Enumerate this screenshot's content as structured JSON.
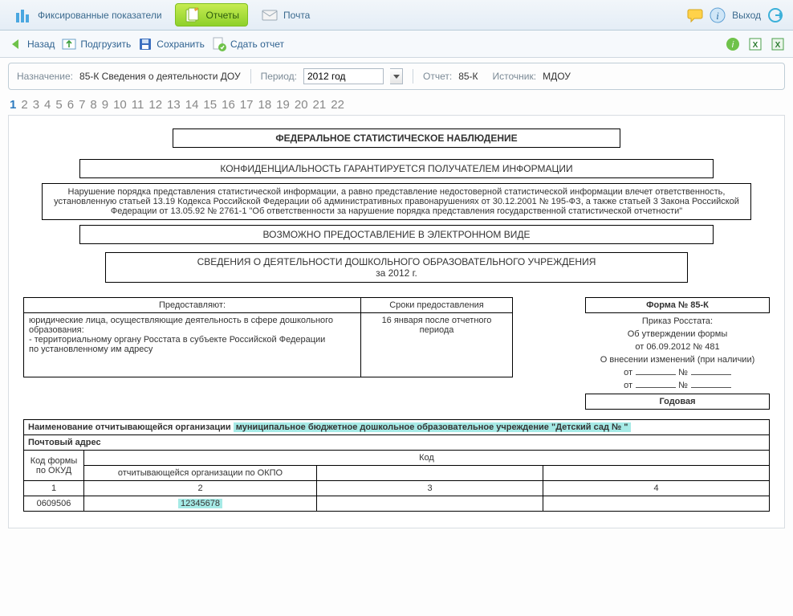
{
  "toolbar1": {
    "fixed": "Фиксированные показатели",
    "reports": "Отчеты",
    "mail": "Почта",
    "exit": "Выход"
  },
  "toolbar2": {
    "back": "Назад",
    "upload": "Подгрузить",
    "save": "Сохранить",
    "submit": "Сдать отчет"
  },
  "meta": {
    "purpose_label": "Назначение:",
    "purpose_value": "85-К Сведения о деятельности ДОУ",
    "period_label": "Период:",
    "period_value": "2012 год",
    "report_label": "Отчет:",
    "report_value": "85-К",
    "source_label": "Источник:",
    "source_value": "МДОУ"
  },
  "pagination": [
    "1",
    "2",
    "3",
    "4",
    "5",
    "6",
    "7",
    "8",
    "9",
    "10",
    "11",
    "12",
    "13",
    "14",
    "15",
    "16",
    "17",
    "18",
    "19",
    "20",
    "21",
    "22"
  ],
  "doc": {
    "title": "ФЕДЕРАЛЬНОЕ СТАТИСТИЧЕСКОЕ НАБЛЮДЕНИЕ",
    "conf": "КОНФИДЕНЦИАЛЬНОСТЬ ГАРАНТИРУЕТСЯ ПОЛУЧАТЕЛЕМ ИНФОРМАЦИИ",
    "violation": "Нарушение порядка представления статистической информации, а равно представление недостоверной статистической информации влечет ответственность, установленную статьей 13.19 Кодекса Российской Федерации об административных правонарушениях от 30.12.2001 № 195-ФЗ, а также статьей 3 Закона Российской Федерации от 13.05.92 № 2761-1 \"Об ответственности за нарушение порядка представления государственной статистической отчетности\"",
    "electronic": "ВОЗМОЖНО ПРЕДОСТАВЛЕНИЕ В ЭЛЕКТРОННОМ ВИДЕ",
    "subject1": "СВЕДЕНИЯ О ДЕЯТЕЛЬНОСТИ ДОШКОЛЬНОГО ОБРАЗОВАТЕЛЬНОГО УЧРЕЖДЕНИЯ",
    "subject2": "за 2012 г."
  },
  "sub": {
    "provide_header": "Предоставляют:",
    "deadline_header": "Сроки предоставления",
    "provide_body": "юридические лица, осуществляющие деятельность в сфере дошкольного образования:\n- территориальному органу Росстата в субъекте Российской Федерации\nпо установленному им адресу",
    "deadline_body": "16 января после отчетного периода"
  },
  "form": {
    "head": "Форма № 85-К",
    "line1": "Приказ Росстата:",
    "line2": "Об утверждении формы",
    "line3": "от 06.09.2012 № 481",
    "line4": "О внесении изменений (при наличии)",
    "from": "от",
    "num": "№",
    "annual": "Годовая"
  },
  "org": {
    "name_label": "Наименование отчитывающейся организации",
    "name_value": "муниципальное бюджетное дошкольное образовательное учреждение \"Детский сад №        \"",
    "addr_label": "Почтовый адрес",
    "code_header": "Код",
    "okud_label": "Код формы по ОКУД",
    "okpo_label": "отчитывающейся организации по ОКПО",
    "col1": "1",
    "col2": "2",
    "col3": "3",
    "col4": "4",
    "okud_value": "0609506",
    "okpo_value": "12345678"
  }
}
